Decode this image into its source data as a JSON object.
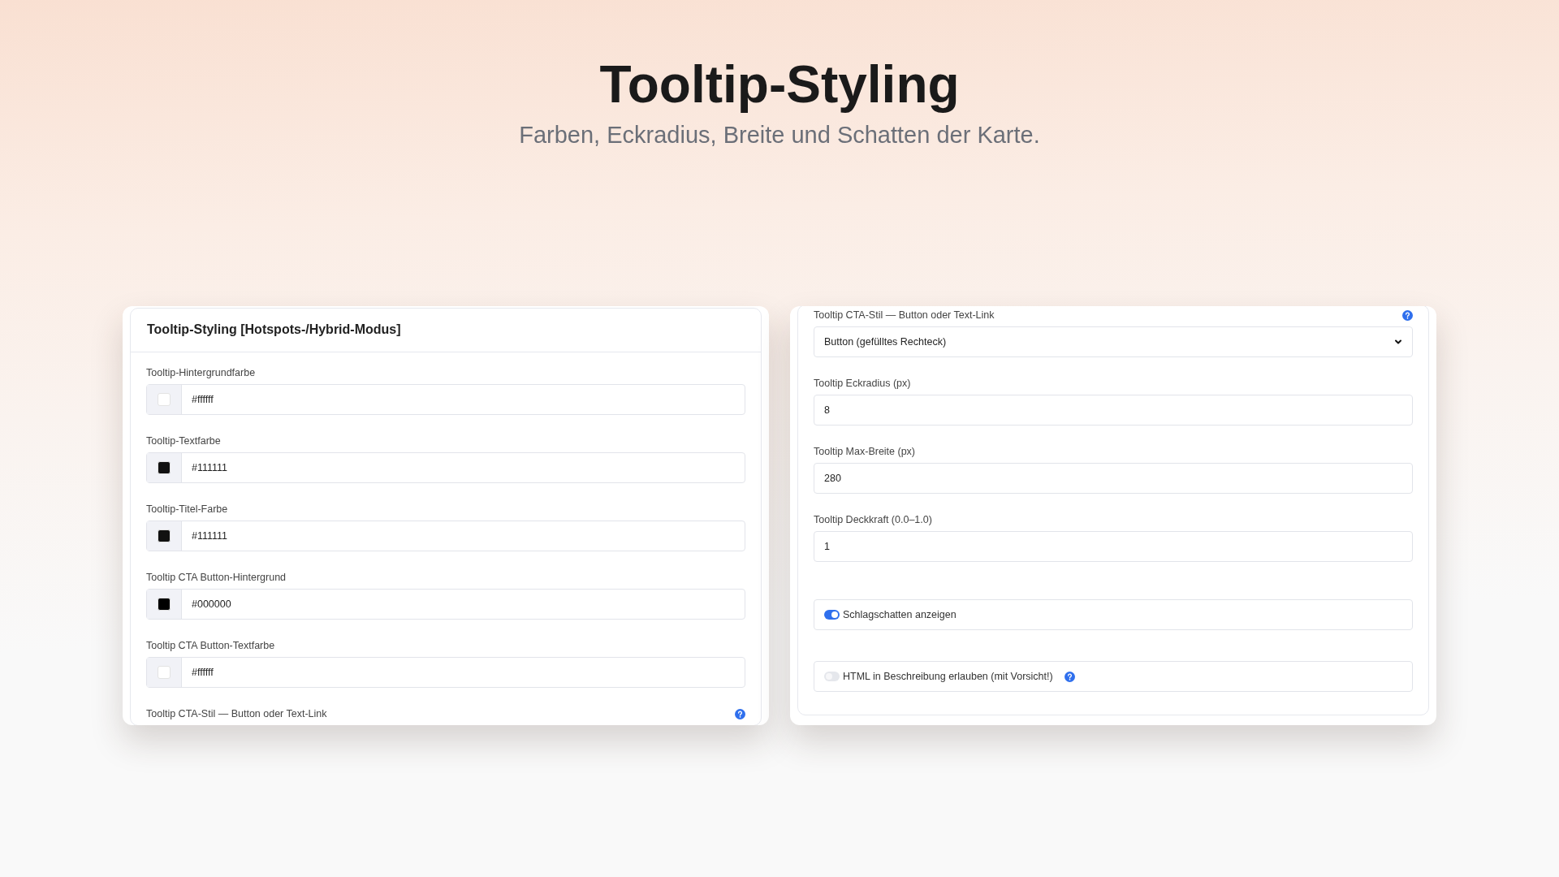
{
  "page": {
    "title": "Tooltip-Styling",
    "subtitle": "Farben, Eckradius, Breite und Schatten der Karte."
  },
  "panels": [
    {
      "header": "Tooltip-Styling [Hotspots-/Hybrid-Modus]",
      "fields": [
        {
          "kind": "color",
          "label": "Tooltip-Hintergrundfarbe",
          "value": "#ffffff",
          "color": "#ffffff"
        },
        {
          "kind": "color",
          "label": "Tooltip-Textfarbe",
          "value": "#111111",
          "color": "#111111"
        },
        {
          "kind": "color",
          "label": "Tooltip-Titel-Farbe",
          "value": "#111111",
          "color": "#111111"
        },
        {
          "kind": "color",
          "label": "Tooltip CTA Button-Hintergrund",
          "value": "#000000",
          "color": "#000000"
        },
        {
          "kind": "color",
          "label": "Tooltip CTA Button-Textfarbe",
          "value": "#ffffff",
          "color": "#ffffff"
        },
        {
          "kind": "label",
          "label": "Tooltip CTA-Stil — Button oder Text-Link",
          "info": true
        }
      ]
    },
    {
      "fields": [
        {
          "kind": "select",
          "label": "Tooltip CTA-Stil — Button oder Text-Link",
          "info": true,
          "value": "Button (gefülltes Rechteck)"
        },
        {
          "kind": "text",
          "label": "Tooltip Eckradius (px)",
          "value": "8"
        },
        {
          "kind": "text",
          "label": "Tooltip Max-Breite (px)",
          "value": "280"
        },
        {
          "kind": "text",
          "label": "Tooltip Deckkraft (0.0–1.0)",
          "value": "1"
        },
        {
          "kind": "toggle",
          "label": "Schlagschatten anzeigen",
          "on": true,
          "info": false
        },
        {
          "kind": "toggle",
          "label": "HTML in Beschreibung erlauben (mit Vorsicht!)",
          "on": false,
          "info": true
        }
      ]
    }
  ]
}
